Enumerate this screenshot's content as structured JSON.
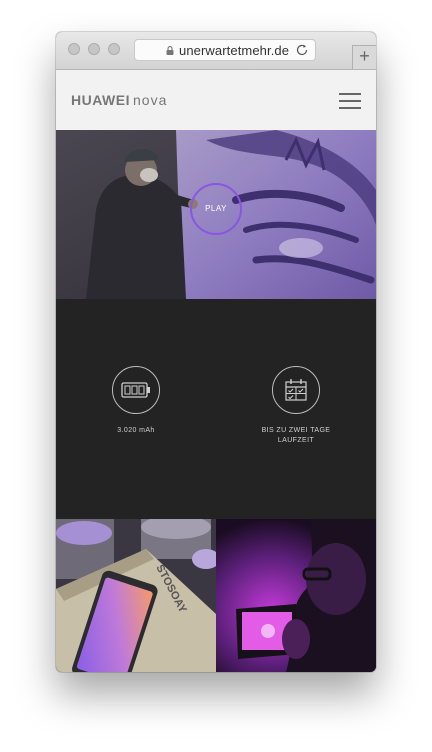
{
  "browser": {
    "url": "unerwartetmehr.de",
    "new_tab_label": "+"
  },
  "site": {
    "brand": "HUAWEI",
    "product": "nova"
  },
  "hero": {
    "play_label": "PLAY"
  },
  "features": [
    {
      "icon": "battery-icon",
      "label": "3.020 mAh"
    },
    {
      "icon": "calendar-icon",
      "label_line1": "BIS ZU ZWEI TAGE",
      "label_line2": "LAUFZEIT"
    }
  ],
  "colors": {
    "accent": "#8a55e0",
    "dark_section": "#232324",
    "header_bg": "#f2f2f2"
  }
}
